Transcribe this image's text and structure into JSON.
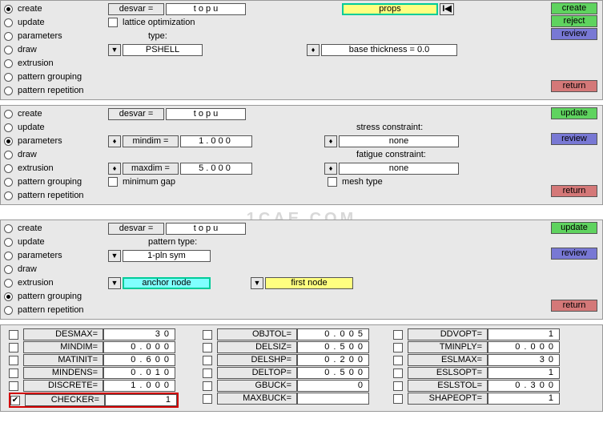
{
  "panel1": {
    "options": [
      "create",
      "update",
      "parameters",
      "draw",
      "extrusion",
      "pattern grouping",
      "pattern repetition"
    ],
    "selected": 0,
    "desvar_label": "desvar =",
    "desvar_value": "t o p u",
    "lattice_label": "lattice optimization",
    "type_label": "type:",
    "type_value": "PSHELL",
    "props_label": "props",
    "base_label": "base thickness = 0.0",
    "right": {
      "create": "create",
      "reject": "reject",
      "review": "review",
      "return": "return"
    }
  },
  "panel2": {
    "options": [
      "create",
      "update",
      "parameters",
      "draw",
      "extrusion",
      "pattern grouping",
      "pattern repetition"
    ],
    "selected": 2,
    "desvar_label": "desvar =",
    "desvar_value": "t o p u",
    "mindim_label": "mindim =",
    "mindim_value": "1 . 0 0 0",
    "maxdim_label": "maxdim =",
    "maxdim_value": "5 . 0 0 0",
    "mingap_label": "minimum gap",
    "stress_label": "stress constraint:",
    "stress_value": "none",
    "fatigue_label": "fatigue constraint:",
    "fatigue_value": "none",
    "mesh_label": "mesh type",
    "right": {
      "update": "update",
      "review": "review",
      "return": "return"
    }
  },
  "panel3": {
    "options": [
      "create",
      "update",
      "parameters",
      "draw",
      "extrusion",
      "pattern grouping",
      "pattern repetition"
    ],
    "selected": 5,
    "desvar_label": "desvar =",
    "desvar_value": "t o p u",
    "pattern_label": "pattern type:",
    "pattern_value": "1-pln  sym",
    "anchor_label": "anchor node",
    "first_label": "first node",
    "right": {
      "update": "update",
      "review": "review",
      "return": "return"
    }
  },
  "grid": {
    "col1": [
      {
        "label": "DESMAX=",
        "value": "3 0"
      },
      {
        "label": "MINDIM=",
        "value": "0 . 0 0 0"
      },
      {
        "label": "MATINIT=",
        "value": "0 . 6 0 0"
      },
      {
        "label": "MINDENS=",
        "value": "0 . 0 1 0"
      },
      {
        "label": "DISCRETE=",
        "value": "1 . 0 0 0"
      },
      {
        "label": "CHECKER=",
        "value": "1",
        "checked": true,
        "highlight": true
      }
    ],
    "col2": [
      {
        "label": "OBJTOL=",
        "value": "0 . 0 0 5"
      },
      {
        "label": "DELSIZ=",
        "value": "0 . 5 0 0"
      },
      {
        "label": "DELSHP=",
        "value": "0 . 2 0 0"
      },
      {
        "label": "DELTOP=",
        "value": "0 . 5 0 0"
      },
      {
        "label": "GBUCK=",
        "value": "0"
      },
      {
        "label": "MAXBUCK=",
        "value": ""
      }
    ],
    "col3": [
      {
        "label": "DDVOPT=",
        "value": "1"
      },
      {
        "label": "TMINPLY=",
        "value": "0 . 0 0 0"
      },
      {
        "label": "ESLMAX=",
        "value": "3 0"
      },
      {
        "label": "ESLSOPT=",
        "value": "1"
      },
      {
        "label": "ESLSTOL=",
        "value": "0 . 3 0 0"
      },
      {
        "label": "SHAPEOPT=",
        "value": "1"
      }
    ]
  },
  "watermark": "1CAE.COM"
}
